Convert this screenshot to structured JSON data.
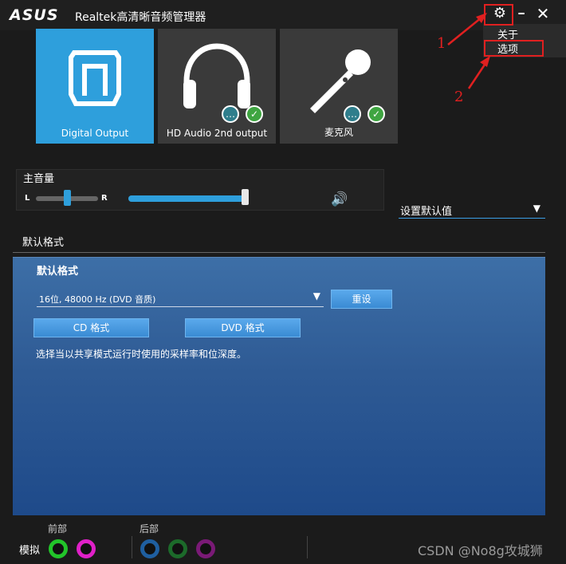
{
  "window": {
    "logo": "ASUS",
    "title": "Realtek高清晰音频管理器",
    "controls": {
      "settings": "⚙",
      "minimize": "━",
      "close": "✕"
    }
  },
  "settings_menu": {
    "items": [
      "关于",
      "选项"
    ]
  },
  "annotations": {
    "marker1": "1",
    "marker2": "2"
  },
  "devices": [
    {
      "label": "Digital Output",
      "icon": "digital-output-icon",
      "active": true
    },
    {
      "label": "HD Audio 2nd output",
      "icon": "headphones-icon",
      "active": false
    },
    {
      "label": "麦克风",
      "icon": "microphone-icon",
      "active": false
    }
  ],
  "badges": {
    "chat": "…",
    "check": "✓"
  },
  "volume": {
    "title": "主音量",
    "left_label": "L",
    "right_label": "R",
    "balance_level": 0.5,
    "master_level": 0.98,
    "speaker_icon": "🔊"
  },
  "default_dropdown": {
    "label": "设置默认值",
    "arrow": "▼"
  },
  "tabs": [
    {
      "label": "默认格式"
    }
  ],
  "format": {
    "section_title": "默认格式",
    "selected": "16位, 48000 Hz (DVD 音质)",
    "arrow": "▼",
    "reset_button": "重设",
    "cd_button": "CD 格式",
    "dvd_button": "DVD 格式",
    "description": "选择当以共享模式运行时使用的采样率和位深度。"
  },
  "connectors": {
    "front_label": "前部",
    "rear_label": "后部",
    "analog_label": "模拟",
    "front_jacks": [
      "#22c42a",
      "#e020c8"
    ],
    "rear_jacks": [
      "#1f5fa0",
      "#1c6a2a",
      "#7a1a76"
    ]
  },
  "watermark": "CSDN @No8g攻城狮",
  "colors": {
    "accent": "#2e9fdc",
    "annotation": "#e02020"
  }
}
